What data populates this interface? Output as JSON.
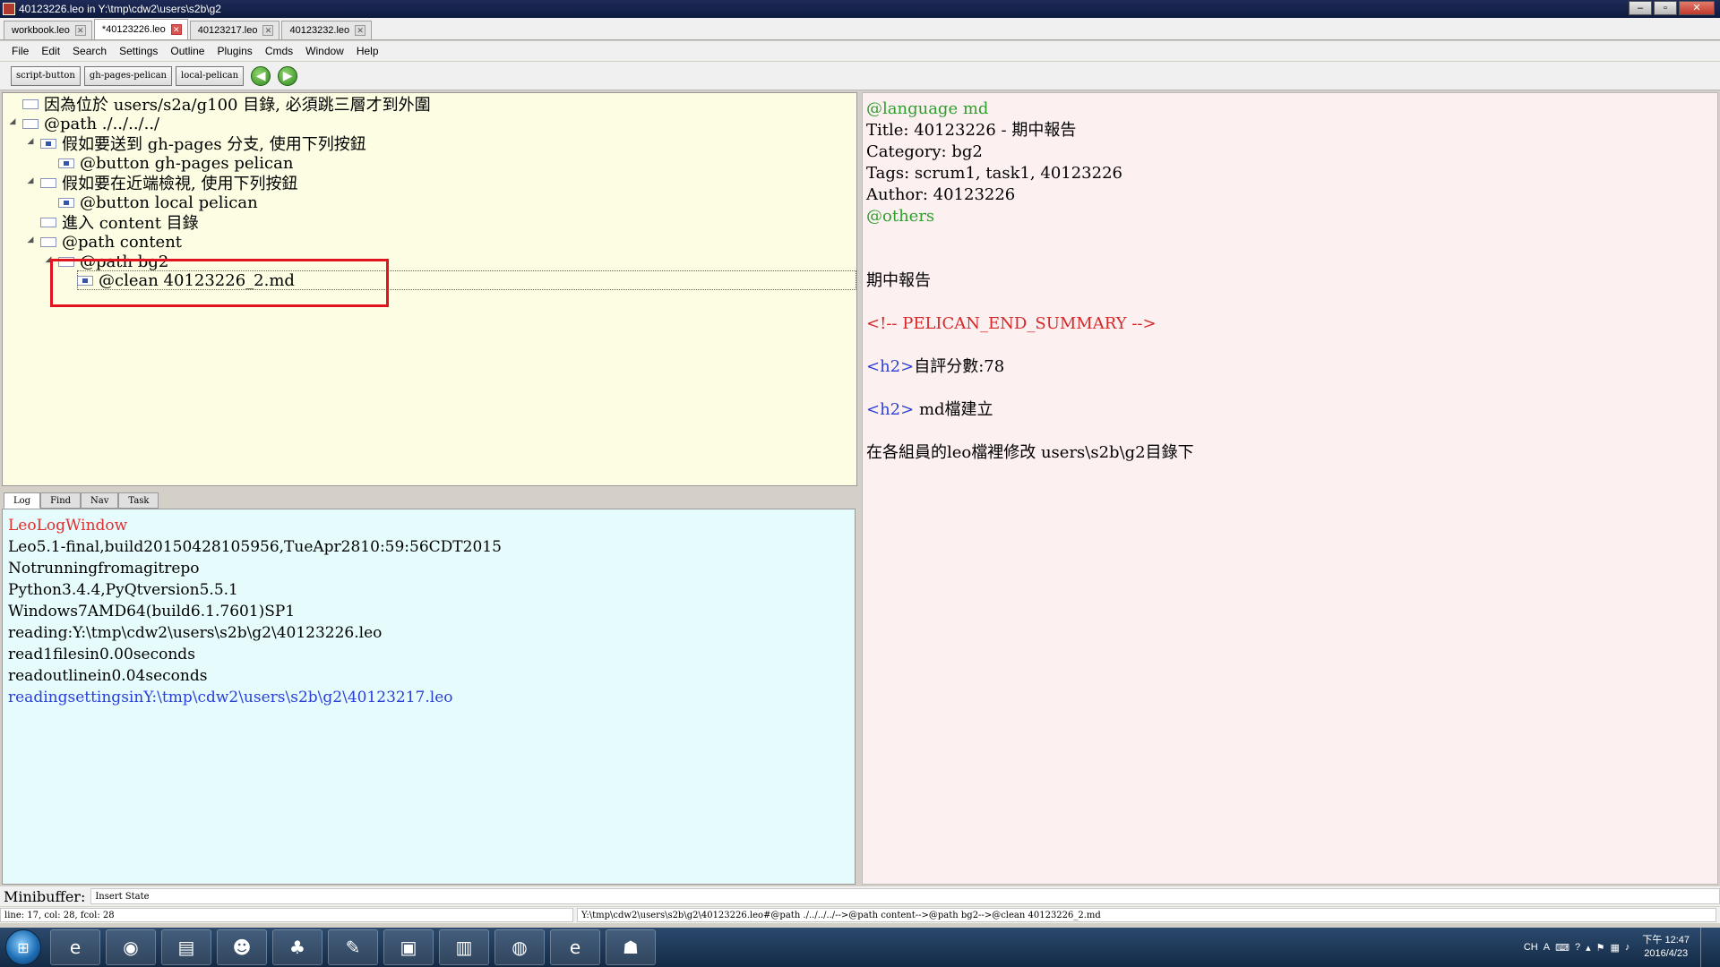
{
  "window": {
    "title": "40123226.leo in Y:\\tmp\\cdw2\\users\\s2b\\g2"
  },
  "tabs": [
    {
      "label": "workbook.leo",
      "active": false
    },
    {
      "label": "*40123226.leo",
      "active": true
    },
    {
      "label": "40123217.leo",
      "active": false
    },
    {
      "label": "40123232.leo",
      "active": false
    }
  ],
  "menu": [
    "File",
    "Edit",
    "Search",
    "Settings",
    "Outline",
    "Plugins",
    "Cmds",
    "Window",
    "Help"
  ],
  "toolbar": {
    "buttons": [
      "script-button",
      "gh-pages-pelican",
      "local-pelican"
    ],
    "back_icon": "arrow-left-icon",
    "forward_icon": "arrow-right-icon"
  },
  "outline": [
    {
      "text": "因為位於 users/s2a/g100 目錄, 必須跳三層才到外圍"
    },
    {
      "text": "@path ./../../../"
    },
    {
      "text": "假如要送到 gh-pages 分支, 使用下列按鈕"
    },
    {
      "text": "@button gh-pages pelican"
    },
    {
      "text": "假如要在近端檢視, 使用下列按鈕"
    },
    {
      "text": "@button local pelican"
    },
    {
      "text": "進入 content 目錄"
    },
    {
      "text": "@path content"
    },
    {
      "text": "@path bg2"
    },
    {
      "text": "@clean 40123226_2.md"
    }
  ],
  "log": {
    "tabs": [
      "Log",
      "Find",
      "Nav",
      "Task"
    ],
    "lines": [
      {
        "text": "LeoLogWindow",
        "color": "#e03030"
      },
      {
        "text": "Leo5.1-final,build20150428105956,TueApr2810:59:56CDT2015",
        "color": "#000000"
      },
      {
        "text": "Notrunningfromagitrepo",
        "color": "#000000"
      },
      {
        "text": "Python3.4.4,PyQtversion5.5.1",
        "color": "#000000"
      },
      {
        "text": "Windows7AMD64(build6.1.7601)SP1",
        "color": "#000000"
      },
      {
        "text": "reading:Y:\\tmp\\cdw2\\users\\s2b\\g2\\40123226.leo",
        "color": "#000000"
      },
      {
        "text": "read1filesin0.00seconds",
        "color": "#000000"
      },
      {
        "text": "readoutlinein0.04seconds",
        "color": "#000000"
      },
      {
        "text": "readingsettingsinY:\\tmp\\cdw2\\users\\s2b\\g2\\40123217.leo",
        "color": "#2a3fd8"
      }
    ]
  },
  "body": {
    "language": "@language md",
    "title": "Title: 40123226 - 期中報告",
    "category": "Category: bg2",
    "tags": "Tags: scrum1, task1, 40123226",
    "author": "Author: 40123226",
    "others": "@others",
    "heading": "期中報告",
    "summary": "<!-- PELICAN_END_SUMMARY -->",
    "h2_tag": "<h2>",
    "score": "自評分數:78",
    "md_build": " md檔建立",
    "instruction": "在各組員的leo檔裡修改 users\\s2b\\g2目錄下",
    "colors": {
      "directive": "#2ca02c",
      "comment": "#d62728",
      "tag": "#2a3fd8"
    }
  },
  "minibuffer": {
    "label": "Minibuffer:",
    "value": "Insert State"
  },
  "status": {
    "left": "line: 17, col: 28, fcol: 28",
    "right": "Y:\\tmp\\cdw2\\users\\s2b\\g2\\40123226.leo#@path ./../../../-->@path content-->@path bg2-->@clean 40123226_2.md"
  },
  "taskbar": {
    "apps": [
      "internet-explorer-icon",
      "chrome-icon",
      "file-explorer-icon",
      "leo-icon",
      "mushroom-icon",
      "notepad-icon",
      "cmd-icon",
      "editor-icon",
      "globe-icon",
      "internet-explorer-icon",
      "leo-editor-icon"
    ],
    "tray": {
      "lang": "CH",
      "time": "下午 12:47",
      "date": "2016/4/23"
    }
  }
}
